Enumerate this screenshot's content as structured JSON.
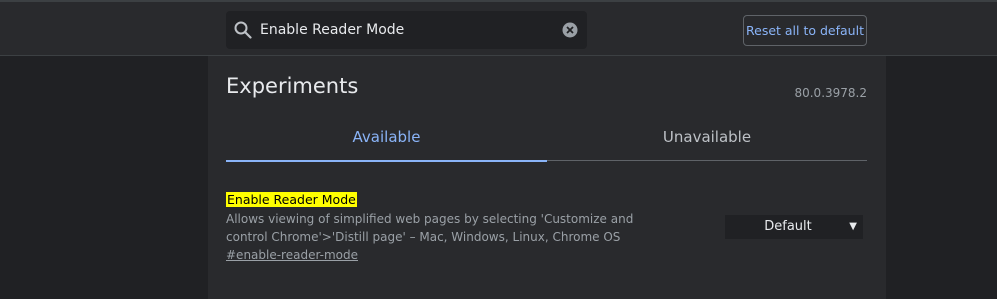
{
  "search": {
    "query": "Enable Reader Mode"
  },
  "header": {
    "reset_label": "Reset all to default"
  },
  "page": {
    "title": "Experiments",
    "version": "80.0.3978.2"
  },
  "tabs": [
    {
      "label": "Available",
      "active": true
    },
    {
      "label": "Unavailable",
      "active": false
    }
  ],
  "experiment": {
    "name": "Enable Reader Mode",
    "description": "Allows viewing of simplified web pages by selecting 'Customize and control Chrome'>'Distill page' – Mac, Windows, Linux, Chrome OS",
    "link": "#enable-reader-mode",
    "selected_value": "Default"
  },
  "colors": {
    "accent": "#8ab4f8",
    "background": "#202124",
    "surface": "#292a2d",
    "highlight": "#ffff00"
  }
}
